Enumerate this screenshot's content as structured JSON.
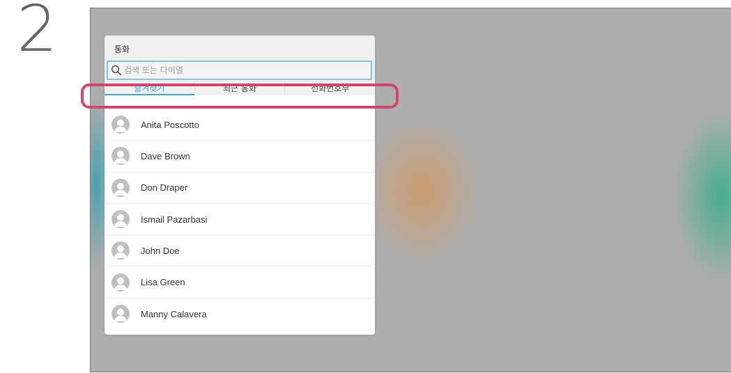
{
  "step_number": "2",
  "panel": {
    "title": "통화",
    "search": {
      "placeholder": "검색 또는 다이얼",
      "value": ""
    },
    "tabs": [
      {
        "label": "즐겨찾기",
        "active": true
      },
      {
        "label": "최근 통화",
        "active": false
      },
      {
        "label": "전화번호부",
        "active": false
      }
    ],
    "contacts": [
      {
        "name": "Anita Poscotto"
      },
      {
        "name": "Dave Brown"
      },
      {
        "name": "Don Draper"
      },
      {
        "name": "Ismail Pazarbasi"
      },
      {
        "name": "John Doe"
      },
      {
        "name": "Lisa Green"
      },
      {
        "name": "Manny Calavera"
      }
    ]
  },
  "colors": {
    "accent": "#2fa6d6",
    "highlight": "#d9406a",
    "screen_bg": "#aeaeae"
  },
  "icons": {
    "search": "search-icon",
    "avatar": "person-avatar-icon"
  }
}
